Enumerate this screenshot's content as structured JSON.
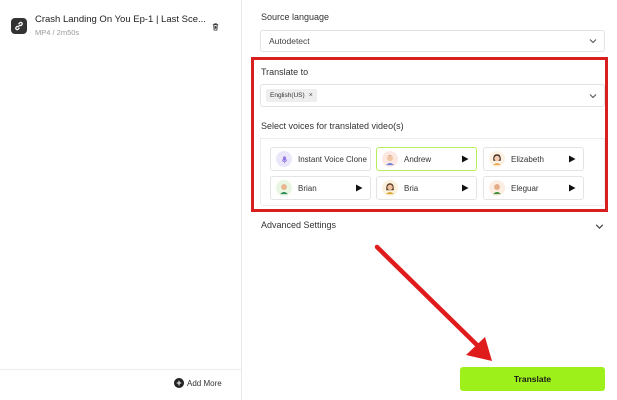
{
  "file": {
    "title": "Crash Landing On You Ep-1 | Last Sce...",
    "meta": "MP4 / 2m50s"
  },
  "left_footer": {
    "add_more_label": "Add More"
  },
  "source_language": {
    "label": "Source language",
    "value": "Autodetect"
  },
  "translate_to": {
    "label": "Translate to",
    "chips": [
      "English(US)"
    ],
    "chip_remove": "×"
  },
  "voices": {
    "label": "Select voices for translated video(s)",
    "items": [
      {
        "name": "Instant Voice Clone",
        "selected": false,
        "has_play": false
      },
      {
        "name": "Andrew",
        "selected": true,
        "has_play": true
      },
      {
        "name": "Elizabeth",
        "selected": false,
        "has_play": true
      },
      {
        "name": "Brian",
        "selected": false,
        "has_play": true
      },
      {
        "name": "Bria",
        "selected": false,
        "has_play": true
      },
      {
        "name": "Eleguar",
        "selected": false,
        "has_play": true
      }
    ]
  },
  "advanced": {
    "label": "Advanced Settings"
  },
  "actions": {
    "translate_label": "Translate"
  },
  "colors": {
    "accent_green": "#9ef01a",
    "highlight_red": "#d81f1f",
    "selected_border": "#b7ef5a"
  }
}
